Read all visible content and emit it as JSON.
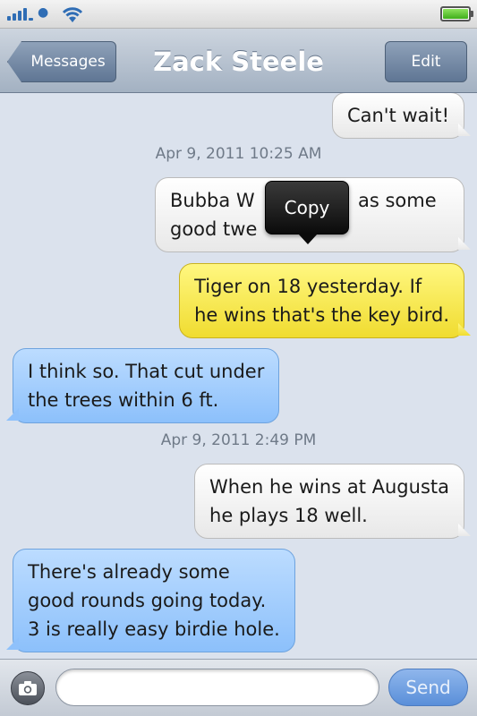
{
  "nav": {
    "back_label": "Messages",
    "title": "Zack Steele",
    "edit_label": "Edit"
  },
  "messages": [
    {
      "type": "outgoing",
      "lines": [
        "Can't wait!"
      ]
    },
    {
      "type": "timestamp",
      "text": "Apr 9, 2011 10:25 AM"
    },
    {
      "type": "outgoing",
      "lines": [
        "Bubba W",
        "good twe"
      ],
      "hidden_behind_popup": true
    },
    {
      "type": "outgoing_highlighted",
      "lines": [
        "Tiger on 18 yesterday. If",
        "he wins that's the key bird."
      ]
    },
    {
      "type": "incoming",
      "lines": [
        "I think so. That cut under",
        "the trees within 6 ft."
      ]
    },
    {
      "type": "timestamp",
      "text": "Apr 9, 2011 2:49 PM"
    },
    {
      "type": "outgoing",
      "lines": [
        "When he wins at Augusta",
        "he plays 18 well."
      ]
    },
    {
      "type": "incoming",
      "lines": [
        "There's already some",
        "good rounds going today.",
        "3 is really easy birdie hole."
      ]
    }
  ],
  "bubble_fragment": "as some",
  "popup": {
    "copy_label": "Copy"
  },
  "input": {
    "placeholder": "",
    "send_label": "Send"
  },
  "colors": {
    "incoming_bubble": "#a6cffd",
    "outgoing_bubble": "#f2f2f2",
    "highlight_bubble": "#f7ea4a",
    "nav_bar": "#a3b1c2",
    "background": "#dbe2ed"
  },
  "icons": {
    "signal": "signal-icon",
    "carrier": "apple-logo-icon",
    "wifi": "wifi-icon",
    "battery": "battery-icon",
    "camera": "camera-icon"
  }
}
